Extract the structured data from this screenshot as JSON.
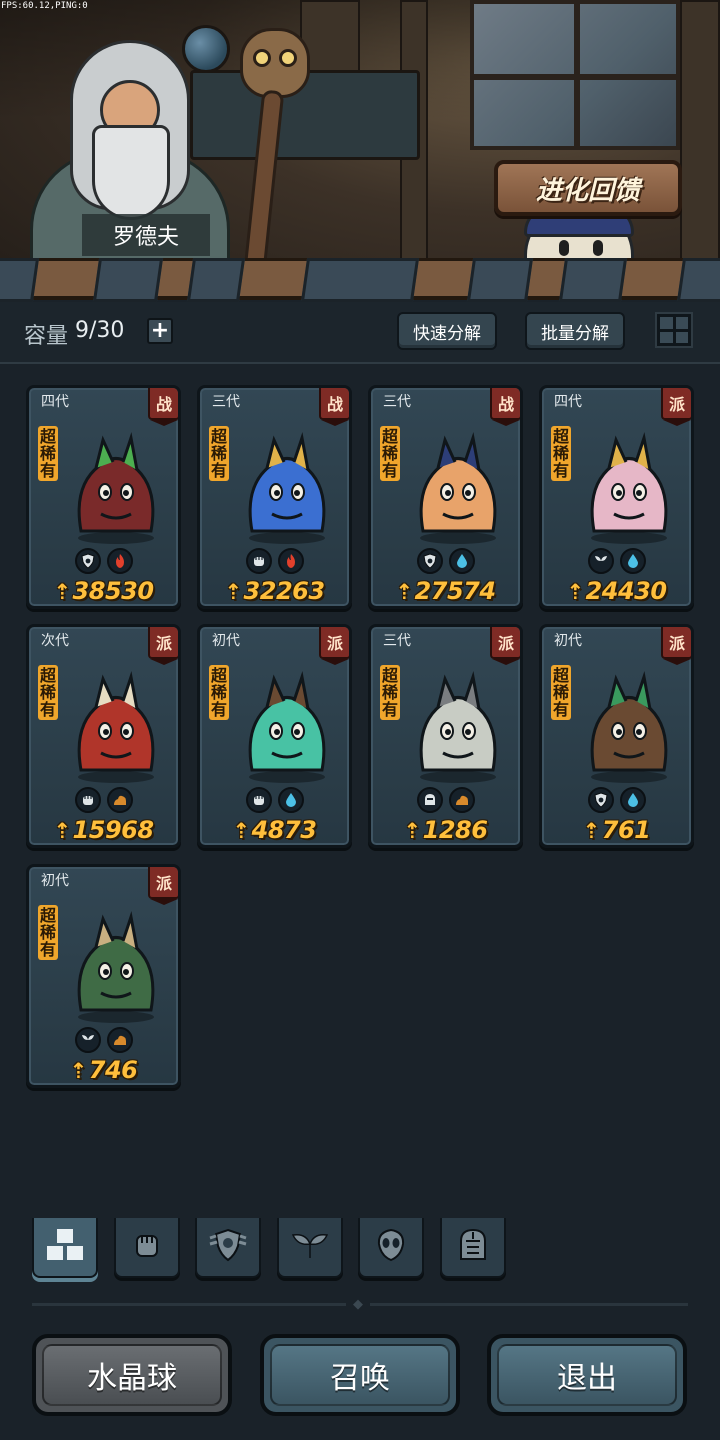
{
  "debug": {
    "fps_text": "FPS:60.12,PING:0"
  },
  "npc": {
    "name": "罗德夫"
  },
  "evolution_button": {
    "label": "进化回馈"
  },
  "inventory": {
    "capacity_label": "容量",
    "capacity_value": "9/30",
    "add_label": "+",
    "quick_decompose_label": "快速分解",
    "batch_decompose_label": "批量分解"
  },
  "cards": [
    {
      "generation": "四代",
      "class": "战",
      "rarity": "超稀有",
      "power": "38530",
      "traits": [
        "shield-icon",
        "fire-icon"
      ],
      "body_color": "#7a2a2a",
      "accent_color": "#4caf50"
    },
    {
      "generation": "三代",
      "class": "战",
      "rarity": "超稀有",
      "power": "32263",
      "traits": [
        "fist-icon",
        "fire-icon"
      ],
      "body_color": "#3b6fd1",
      "accent_color": "#e0b24a"
    },
    {
      "generation": "三代",
      "class": "战",
      "rarity": "超稀有",
      "power": "27574",
      "traits": [
        "shield-icon",
        "water-icon"
      ],
      "body_color": "#e8a36a",
      "accent_color": "#2d3e78"
    },
    {
      "generation": "四代",
      "class": "派",
      "rarity": "超稀有",
      "power": "24430",
      "traits": [
        "leaf-icon",
        "water-icon"
      ],
      "body_color": "#e6b7c7",
      "accent_color": "#e0b24a"
    },
    {
      "generation": "次代",
      "class": "派",
      "rarity": "超稀有",
      "power": "15968",
      "traits": [
        "fist-icon",
        "earth-icon"
      ],
      "body_color": "#b0352a",
      "accent_color": "#e6dcc2"
    },
    {
      "generation": "初代",
      "class": "派",
      "rarity": "超稀有",
      "power": "4873",
      "traits": [
        "fist-icon",
        "water-icon"
      ],
      "body_color": "#48c2a4",
      "accent_color": "#6a4a32"
    },
    {
      "generation": "三代",
      "class": "派",
      "rarity": "超稀有",
      "power": "1286",
      "traits": [
        "helm-icon",
        "earth-icon"
      ],
      "body_color": "#c8ccc4",
      "accent_color": "#7a7d80"
    },
    {
      "generation": "初代",
      "class": "派",
      "rarity": "超稀有",
      "power": "761",
      "traits": [
        "shield-icon",
        "water-icon"
      ],
      "body_color": "#6a4a32",
      "accent_color": "#3a9a5e"
    },
    {
      "generation": "初代",
      "class": "派",
      "rarity": "超稀有",
      "power": "746",
      "traits": [
        "leaf-icon",
        "earth-icon"
      ],
      "body_color": "#3f6b45",
      "accent_color": "#c9b081"
    }
  ],
  "filter_tabs": [
    {
      "icon": "all-blocks-icon",
      "active": true
    },
    {
      "icon": "fist-icon",
      "active": false
    },
    {
      "icon": "shield-icon",
      "active": false
    },
    {
      "icon": "leaf-icon",
      "active": false
    },
    {
      "icon": "alien-head-icon",
      "active": false
    },
    {
      "icon": "helm-icon",
      "active": false
    }
  ],
  "bottom_buttons": {
    "crystal_ball_label": "水晶球",
    "summon_label": "召唤",
    "exit_label": "退出"
  },
  "colors": {
    "background": "#1a2229",
    "card": "#2f4350",
    "power_text": "#ffbf3c",
    "rarity_tag": "#f0a62c",
    "class_badge": "#7f2b25",
    "button_grey": "#4f5357",
    "button_teal": "#3b5562"
  }
}
